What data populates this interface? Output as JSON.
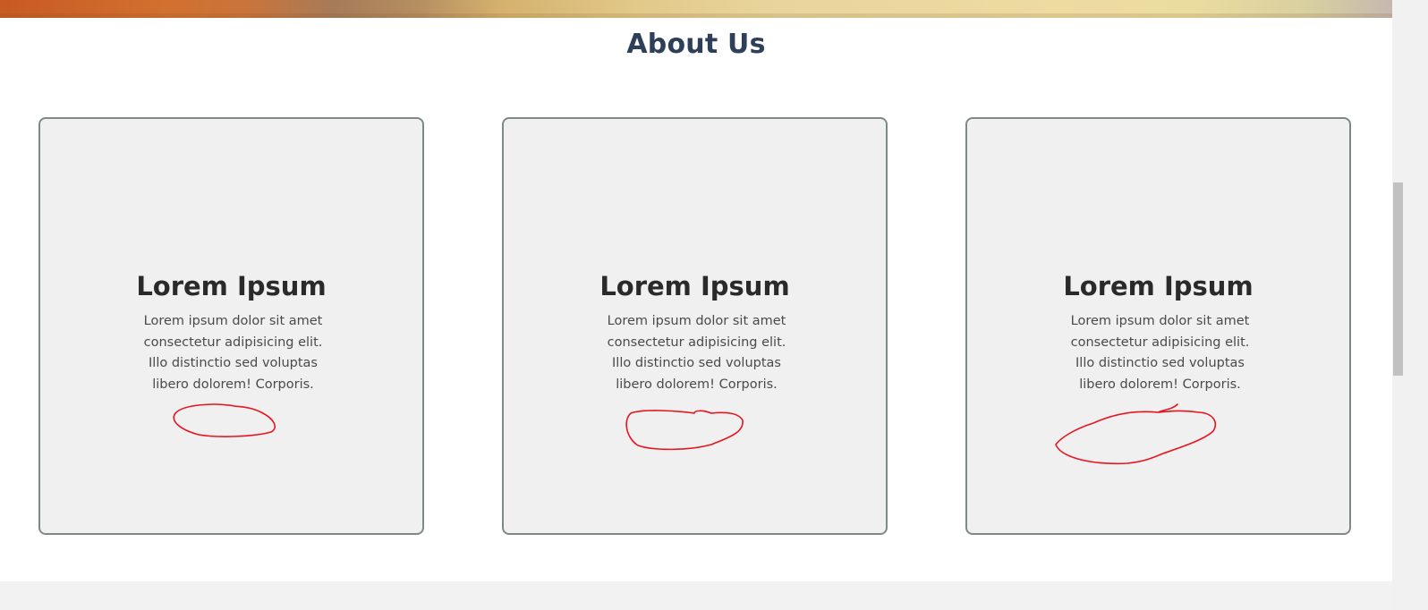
{
  "about": {
    "title": "About Us"
  },
  "cards": [
    {
      "title": "Lorem Ipsum",
      "text": "Lorem ipsum dolor sit amet consectetur adipisicing elit. Illo distinctio sed voluptas libero dolorem! Corporis."
    },
    {
      "title": "Lorem Ipsum",
      "text": "Lorem ipsum dolor sit amet consectetur adipisicing elit. Illo distinctio sed voluptas libero dolorem! Corporis."
    },
    {
      "title": "Lorem Ipsum",
      "text": "Lorem ipsum dolor sit amet consectetur adipisicing elit. Illo distinctio sed voluptas libero dolorem! Corporis."
    }
  ],
  "colors": {
    "title": "#2e3f59",
    "card_background": "#f0f0f0",
    "card_border": "#7d8a88",
    "annotation": "#e8141e"
  }
}
